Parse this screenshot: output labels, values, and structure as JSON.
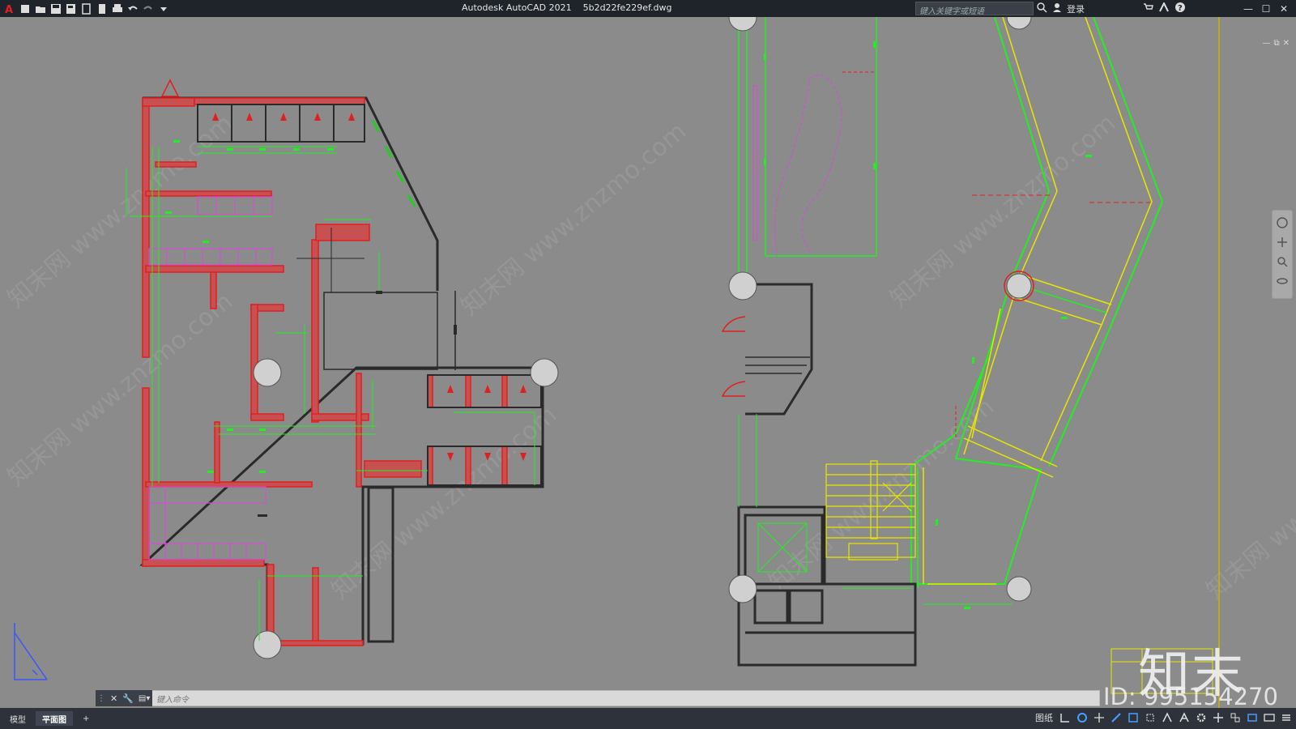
{
  "app": {
    "title": "Autodesk AutoCAD 2021",
    "filename": "5b2d22fe229ef.dwg",
    "search_placeholder": "键入关键字或短语",
    "login": "登录",
    "accent": "#e02020"
  },
  "quick_access": [
    "new-icon",
    "open-icon",
    "save-icon",
    "saveas-icon",
    "publish-icon",
    "plot-preview-icon",
    "print-icon",
    "undo-icon",
    "redo-icon",
    "customize-icon"
  ],
  "window_controls": [
    "minimize-icon",
    "maximize-icon",
    "close-icon"
  ],
  "drawing": {
    "colors": {
      "background": "#8b8b8b",
      "wall": "#e02020",
      "wall_fill": "#c04040",
      "dimension": "#22ee22",
      "outline": "#2a2a2a",
      "furniture": "#d24fd2",
      "stairs": "#e6e600",
      "column": "#d0d0d0"
    }
  },
  "watermark": {
    "logo": "知末",
    "id": "ID: 995154270",
    "diagonal": "知末网 www.znzmo.com"
  },
  "command_line": {
    "placeholder": "键入命令"
  },
  "layout_tabs": [
    {
      "label": "模型",
      "active": false
    },
    {
      "label": "平面图",
      "active": true
    }
  ],
  "status_bar": {
    "paper_label": "图纸"
  }
}
